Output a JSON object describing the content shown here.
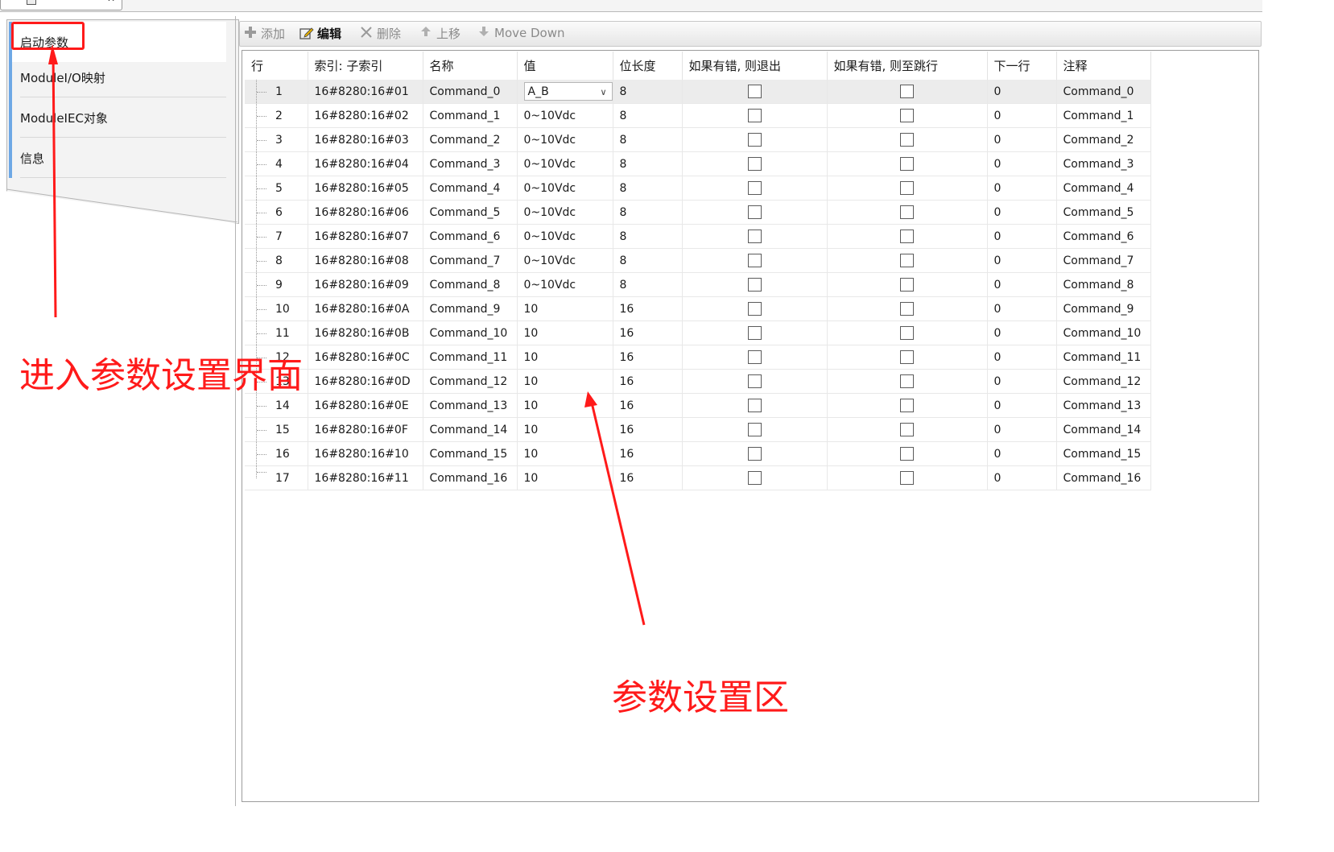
{
  "left_tabs": [
    {
      "label": "启动参数",
      "active": true
    },
    {
      "label": "ModuleI/O映射",
      "active": false
    },
    {
      "label": "ModuleIEC对象",
      "active": false
    },
    {
      "label": "信息",
      "active": false
    }
  ],
  "toolbar": {
    "add": "添加",
    "edit": "编辑",
    "delete": "删除",
    "move_up": "上移",
    "move_down": "Move Down"
  },
  "table": {
    "columns": [
      "行",
      "索引: 子索引",
      "名称",
      "值",
      "位长度",
      "如果有错, 则退出",
      "如果有错, 则至跳行",
      "下一行",
      "注释"
    ],
    "rows": [
      {
        "row": "1",
        "index": "16#8280:16#01",
        "name": "Command_0",
        "value": "A_B",
        "bits": "8",
        "next": "0",
        "comment": "Command_0"
      },
      {
        "row": "2",
        "index": "16#8280:16#02",
        "name": "Command_1",
        "value": "0~10Vdc",
        "bits": "8",
        "next": "0",
        "comment": "Command_1"
      },
      {
        "row": "3",
        "index": "16#8280:16#03",
        "name": "Command_2",
        "value": "0~10Vdc",
        "bits": "8",
        "next": "0",
        "comment": "Command_2"
      },
      {
        "row": "4",
        "index": "16#8280:16#04",
        "name": "Command_3",
        "value": "0~10Vdc",
        "bits": "8",
        "next": "0",
        "comment": "Command_3"
      },
      {
        "row": "5",
        "index": "16#8280:16#05",
        "name": "Command_4",
        "value": "0~10Vdc",
        "bits": "8",
        "next": "0",
        "comment": "Command_4"
      },
      {
        "row": "6",
        "index": "16#8280:16#06",
        "name": "Command_5",
        "value": "0~10Vdc",
        "bits": "8",
        "next": "0",
        "comment": "Command_5"
      },
      {
        "row": "7",
        "index": "16#8280:16#07",
        "name": "Command_6",
        "value": "0~10Vdc",
        "bits": "8",
        "next": "0",
        "comment": "Command_6"
      },
      {
        "row": "8",
        "index": "16#8280:16#08",
        "name": "Command_7",
        "value": "0~10Vdc",
        "bits": "8",
        "next": "0",
        "comment": "Command_7"
      },
      {
        "row": "9",
        "index": "16#8280:16#09",
        "name": "Command_8",
        "value": "0~10Vdc",
        "bits": "8",
        "next": "0",
        "comment": "Command_8"
      },
      {
        "row": "10",
        "index": "16#8280:16#0A",
        "name": "Command_9",
        "value": "10",
        "bits": "16",
        "next": "0",
        "comment": "Command_9"
      },
      {
        "row": "11",
        "index": "16#8280:16#0B",
        "name": "Command_10",
        "value": "10",
        "bits": "16",
        "next": "0",
        "comment": "Command_10"
      },
      {
        "row": "12",
        "index": "16#8280:16#0C",
        "name": "Command_11",
        "value": "10",
        "bits": "16",
        "next": "0",
        "comment": "Command_11"
      },
      {
        "row": "13",
        "index": "16#8280:16#0D",
        "name": "Command_12",
        "value": "10",
        "bits": "16",
        "next": "0",
        "comment": "Command_12"
      },
      {
        "row": "14",
        "index": "16#8280:16#0E",
        "name": "Command_13",
        "value": "10",
        "bits": "16",
        "next": "0",
        "comment": "Command_13"
      },
      {
        "row": "15",
        "index": "16#8280:16#0F",
        "name": "Command_14",
        "value": "10",
        "bits": "16",
        "next": "0",
        "comment": "Command_14"
      },
      {
        "row": "16",
        "index": "16#8280:16#10",
        "name": "Command_15",
        "value": "10",
        "bits": "16",
        "next": "0",
        "comment": "Command_15"
      },
      {
        "row": "17",
        "index": "16#8280:16#11",
        "name": "Command_16",
        "value": "10",
        "bits": "16",
        "next": "0",
        "comment": "Command_16"
      }
    ]
  },
  "annotations": {
    "enter_text": "进入参数设置界面",
    "area_text": "参数设置区",
    "color": "#ff1a1a"
  },
  "icons": {
    "add": "plus-icon",
    "edit": "pencil-icon",
    "delete": "x-icon",
    "move_up": "arrow-up-icon",
    "move_down": "arrow-down-icon"
  }
}
